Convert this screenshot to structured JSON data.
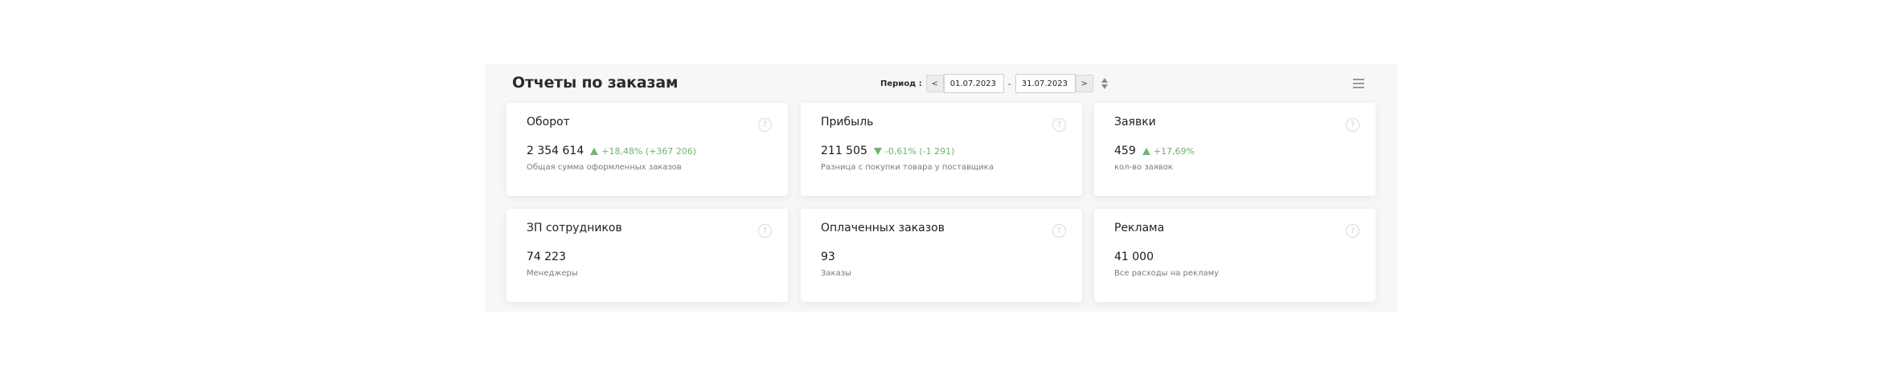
{
  "header": {
    "title": "Отчеты по заказам",
    "period_label": "Период :",
    "prev_label": "<",
    "next_label": ">",
    "date_from": "01.07.2023",
    "date_to": "31.07.2023",
    "separator": "-"
  },
  "cards": [
    {
      "title": "Оборот",
      "value": "2 354 614",
      "delta": "+18,48% (+367 206)",
      "trend": "up",
      "desc": "Общая сумма оформленных заказов"
    },
    {
      "title": "Прибыль",
      "value": "211 505",
      "delta": "-0,61% (-1 291)",
      "trend": "down",
      "desc": "Разница с покупки товара у поставщика"
    },
    {
      "title": "Заявки",
      "value": "459",
      "delta": "+17,69%",
      "trend": "up",
      "desc": "кол-во заявок"
    },
    {
      "title": "ЗП сотрудников",
      "value": "74 223",
      "delta": "",
      "trend": "",
      "desc": "Менеджеры"
    },
    {
      "title": "Оплаченных заказов",
      "value": "93",
      "delta": "",
      "trend": "",
      "desc": "Заказы"
    },
    {
      "title": "Реклама",
      "value": "41 000",
      "delta": "",
      "trend": "",
      "desc": "Все расходы на рекламу"
    }
  ],
  "help_symbol": "?",
  "colors": {
    "positive": "#6fb36f",
    "panel_bg": "#f7f7f7"
  },
  "icons": {
    "menu": "hamburger-icon",
    "sort": "sort-icon",
    "help": "help-circle-icon"
  }
}
